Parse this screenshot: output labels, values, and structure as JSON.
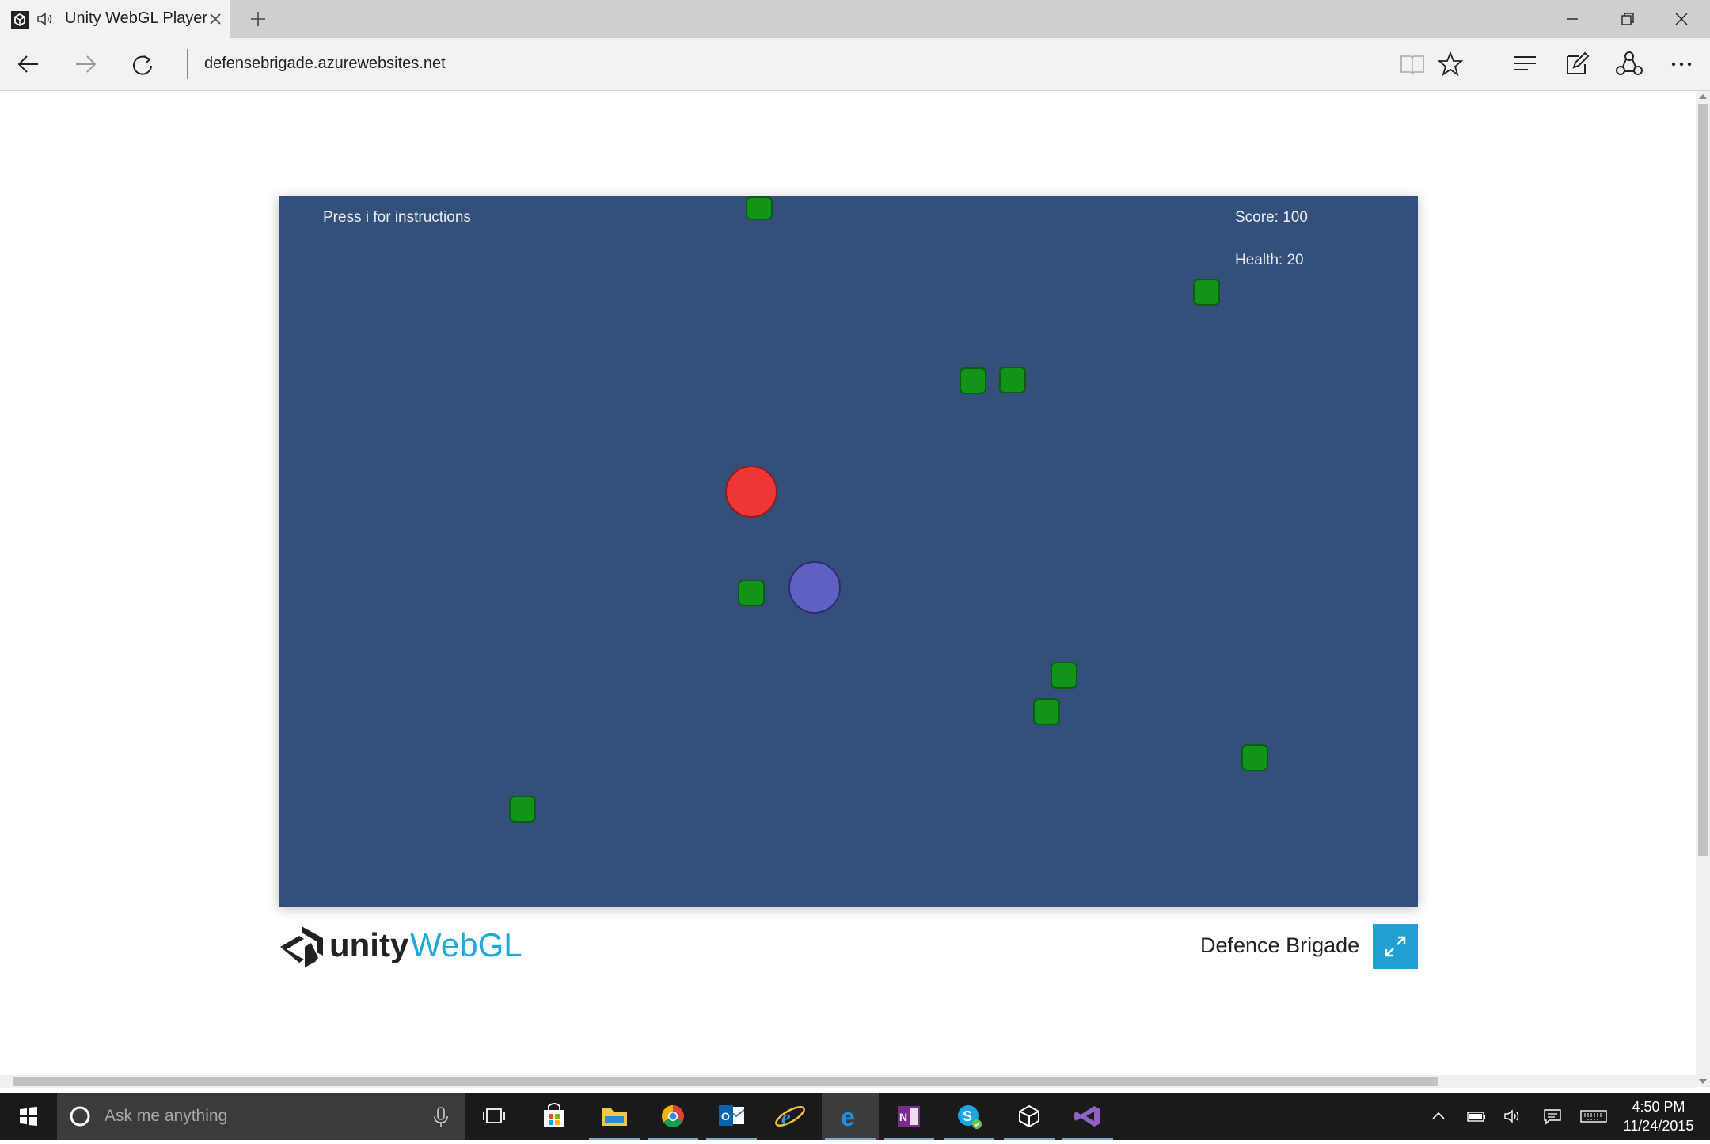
{
  "browser": {
    "tab_title": "Unity WebGL Player",
    "url": "defensebrigade.azurewebsites.net"
  },
  "game": {
    "instructions": "Press i for instructions",
    "score": "Score: 100",
    "health": "Health: 20",
    "colors": {
      "background": "#334f7a",
      "green_block": "#129418",
      "red_enemy": "#f03535",
      "player": "#5f5fc4"
    }
  },
  "footer": {
    "logo_unity": "unity",
    "logo_webgl": "WebGL",
    "title": "Defence Brigade"
  },
  "taskbar": {
    "search_placeholder": "Ask me anything",
    "time": "4:50 PM",
    "date": "11/24/2015",
    "apps": [
      "task-view",
      "store",
      "file-explorer",
      "chrome",
      "outlook",
      "internet-explorer",
      "edge",
      "onenote",
      "skype",
      "unity",
      "visual-studio"
    ]
  }
}
